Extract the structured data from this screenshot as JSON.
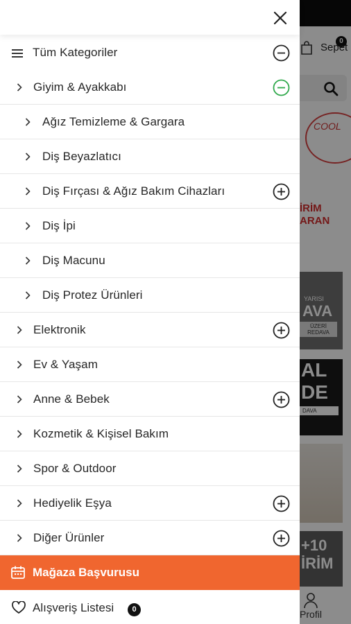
{
  "background": {
    "cart_label": "Sepet",
    "cart_count": "0",
    "banner_cool": "COOL",
    "banner_red_line1": "İRİM",
    "banner_red_line2": "ARAN",
    "banner_gray_top": "YARISI",
    "banner_gray_big": "AVA",
    "banner_gray_box": "ÜZERİ REDAVA",
    "banner_black_line1": "AL",
    "banner_black_line2": "DE",
    "banner_black_box": "DAVA",
    "banner_dark_line1": "+10",
    "banner_dark_line2": "İRİM",
    "profile_label": "Profil"
  },
  "drawer": {
    "close_icon": "close-icon",
    "all_categories": "Tüm Kategoriler",
    "categories": [
      {
        "label": "Giyim & Ayakkabı",
        "level": 1,
        "toggle": "minus-green"
      },
      {
        "label": "Ağız Temizleme & Gargara",
        "level": 2,
        "toggle": null
      },
      {
        "label": "Diş Beyazlatıcı",
        "level": 2,
        "toggle": null
      },
      {
        "label": "Diş Fırçası & Ağız Bakım Cihazları",
        "level": 2,
        "toggle": "plus"
      },
      {
        "label": "Diş İpi",
        "level": 2,
        "toggle": null
      },
      {
        "label": "Diş Macunu",
        "level": 2,
        "toggle": null
      },
      {
        "label": "Diş Protez Ürünleri",
        "level": 2,
        "toggle": null
      },
      {
        "label": "Elektronik",
        "level": 1,
        "toggle": "plus"
      },
      {
        "label": "Ev & Yaşam",
        "level": 1,
        "toggle": null
      },
      {
        "label": "Anne & Bebek",
        "level": 1,
        "toggle": "plus"
      },
      {
        "label": "Kozmetik & Kişisel Bakım",
        "level": 1,
        "toggle": null
      },
      {
        "label": "Spor & Outdoor",
        "level": 1,
        "toggle": null
      },
      {
        "label": "Hediyelik Eşya",
        "level": 1,
        "toggle": "plus"
      },
      {
        "label": "Diğer Ürünler",
        "level": 1,
        "toggle": "plus"
      }
    ],
    "store_application": "Mağaza Başvurusu",
    "wishlist": "Alışveriş Listesi",
    "wishlist_count": "0"
  },
  "colors": {
    "accent_orange": "#f0662f",
    "expanded_green": "#2ea84a",
    "text": "#262626"
  }
}
